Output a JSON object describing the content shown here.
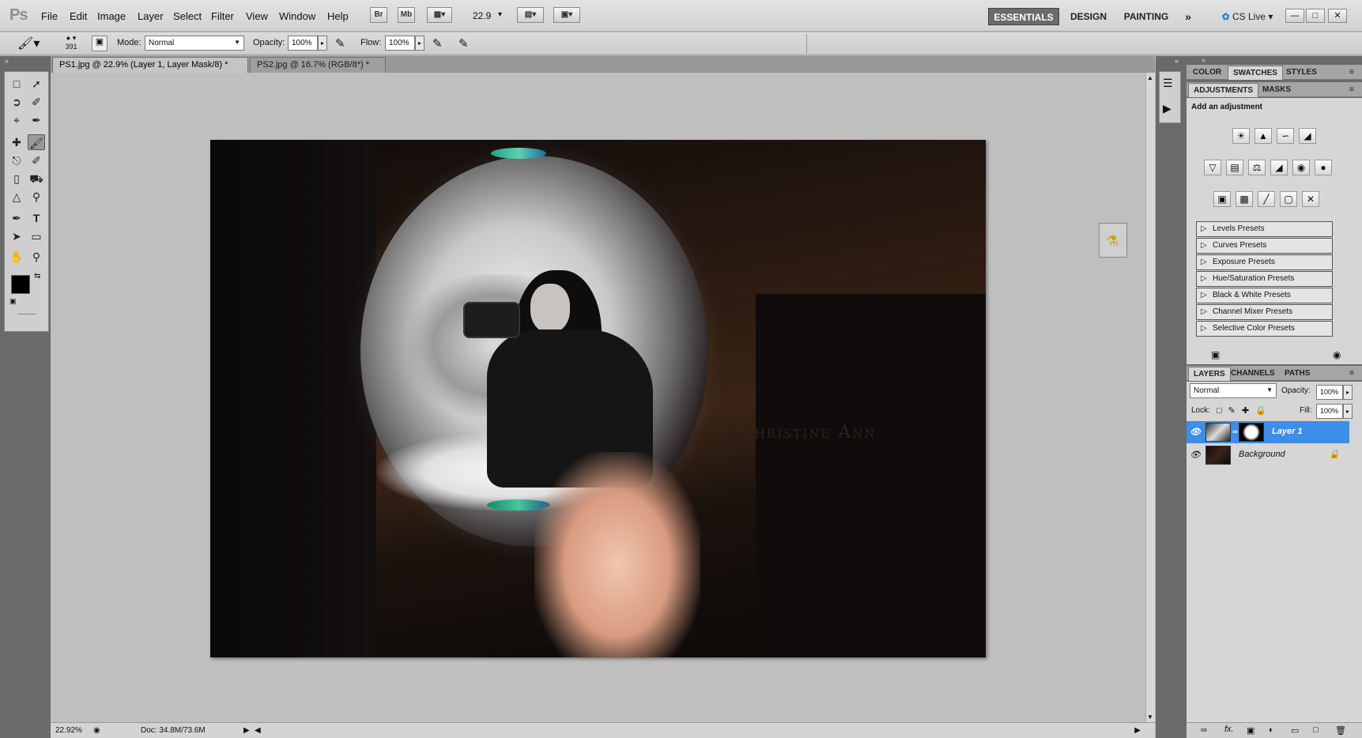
{
  "app": {
    "logo": "Ps"
  },
  "menu": [
    "File",
    "Edit",
    "Image",
    "Layer",
    "Select",
    "Filter",
    "View",
    "Window",
    "Help"
  ],
  "appbar": {
    "bridge": "Br",
    "minibridge": "Mb",
    "zoom": "22.9"
  },
  "workspaces": [
    "ESSENTIALS",
    "DESIGN",
    "PAINTING"
  ],
  "cslive": "CS Live",
  "options": {
    "brush_size": "391",
    "mode_label": "Mode:",
    "mode_value": "Normal",
    "opacity_label": "Opacity:",
    "opacity_value": "100%",
    "flow_label": "Flow:",
    "flow_value": "100%"
  },
  "doc_tabs": [
    {
      "label": "PS1.jpg @ 22.9% (Layer 1, Layer Mask/8) *"
    },
    {
      "label": "PS2.jpg @ 16.7% (RGB/8*) *"
    }
  ],
  "watermark": "Christine Ann",
  "status": {
    "zoom": "22.92%",
    "doc": "Doc: 34.8M/73.6M"
  },
  "color_panel": {
    "tabs": [
      "COLOR",
      "SWATCHES",
      "STYLES"
    ]
  },
  "adjustments": {
    "tabs": [
      "ADJUSTMENTS",
      "MASKS"
    ],
    "heading": "Add an adjustment",
    "presets": [
      "Levels Presets",
      "Curves Presets",
      "Exposure Presets",
      "Hue/Saturation Presets",
      "Black & White Presets",
      "Channel Mixer Presets",
      "Selective Color Presets"
    ]
  },
  "layers_panel": {
    "tabs": [
      "LAYERS",
      "CHANNELS",
      "PATHS"
    ],
    "blend_mode": "Normal",
    "opacity_label": "Opacity:",
    "opacity_value": "100%",
    "lock_label": "Lock:",
    "fill_label": "Fill:",
    "fill_value": "100%",
    "layers": [
      {
        "name": "Layer 1",
        "selected": true
      },
      {
        "name": "Background",
        "selected": false
      }
    ]
  },
  "colors": {
    "accent": "#3b8fe0",
    "selected_layer": "#3d8ee6"
  }
}
